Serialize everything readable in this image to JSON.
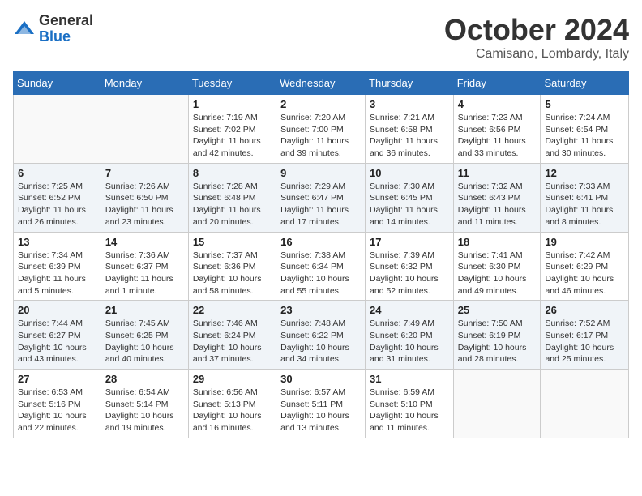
{
  "header": {
    "logo_general": "General",
    "logo_blue": "Blue",
    "month": "October 2024",
    "location": "Camisano, Lombardy, Italy"
  },
  "weekdays": [
    "Sunday",
    "Monday",
    "Tuesday",
    "Wednesday",
    "Thursday",
    "Friday",
    "Saturday"
  ],
  "weeks": [
    [
      {
        "day": "",
        "info": ""
      },
      {
        "day": "",
        "info": ""
      },
      {
        "day": "1",
        "info": "Sunrise: 7:19 AM\nSunset: 7:02 PM\nDaylight: 11 hours and 42 minutes."
      },
      {
        "day": "2",
        "info": "Sunrise: 7:20 AM\nSunset: 7:00 PM\nDaylight: 11 hours and 39 minutes."
      },
      {
        "day": "3",
        "info": "Sunrise: 7:21 AM\nSunset: 6:58 PM\nDaylight: 11 hours and 36 minutes."
      },
      {
        "day": "4",
        "info": "Sunrise: 7:23 AM\nSunset: 6:56 PM\nDaylight: 11 hours and 33 minutes."
      },
      {
        "day": "5",
        "info": "Sunrise: 7:24 AM\nSunset: 6:54 PM\nDaylight: 11 hours and 30 minutes."
      }
    ],
    [
      {
        "day": "6",
        "info": "Sunrise: 7:25 AM\nSunset: 6:52 PM\nDaylight: 11 hours and 26 minutes."
      },
      {
        "day": "7",
        "info": "Sunrise: 7:26 AM\nSunset: 6:50 PM\nDaylight: 11 hours and 23 minutes."
      },
      {
        "day": "8",
        "info": "Sunrise: 7:28 AM\nSunset: 6:48 PM\nDaylight: 11 hours and 20 minutes."
      },
      {
        "day": "9",
        "info": "Sunrise: 7:29 AM\nSunset: 6:47 PM\nDaylight: 11 hours and 17 minutes."
      },
      {
        "day": "10",
        "info": "Sunrise: 7:30 AM\nSunset: 6:45 PM\nDaylight: 11 hours and 14 minutes."
      },
      {
        "day": "11",
        "info": "Sunrise: 7:32 AM\nSunset: 6:43 PM\nDaylight: 11 hours and 11 minutes."
      },
      {
        "day": "12",
        "info": "Sunrise: 7:33 AM\nSunset: 6:41 PM\nDaylight: 11 hours and 8 minutes."
      }
    ],
    [
      {
        "day": "13",
        "info": "Sunrise: 7:34 AM\nSunset: 6:39 PM\nDaylight: 11 hours and 5 minutes."
      },
      {
        "day": "14",
        "info": "Sunrise: 7:36 AM\nSunset: 6:37 PM\nDaylight: 11 hours and 1 minute."
      },
      {
        "day": "15",
        "info": "Sunrise: 7:37 AM\nSunset: 6:36 PM\nDaylight: 10 hours and 58 minutes."
      },
      {
        "day": "16",
        "info": "Sunrise: 7:38 AM\nSunset: 6:34 PM\nDaylight: 10 hours and 55 minutes."
      },
      {
        "day": "17",
        "info": "Sunrise: 7:39 AM\nSunset: 6:32 PM\nDaylight: 10 hours and 52 minutes."
      },
      {
        "day": "18",
        "info": "Sunrise: 7:41 AM\nSunset: 6:30 PM\nDaylight: 10 hours and 49 minutes."
      },
      {
        "day": "19",
        "info": "Sunrise: 7:42 AM\nSunset: 6:29 PM\nDaylight: 10 hours and 46 minutes."
      }
    ],
    [
      {
        "day": "20",
        "info": "Sunrise: 7:44 AM\nSunset: 6:27 PM\nDaylight: 10 hours and 43 minutes."
      },
      {
        "day": "21",
        "info": "Sunrise: 7:45 AM\nSunset: 6:25 PM\nDaylight: 10 hours and 40 minutes."
      },
      {
        "day": "22",
        "info": "Sunrise: 7:46 AM\nSunset: 6:24 PM\nDaylight: 10 hours and 37 minutes."
      },
      {
        "day": "23",
        "info": "Sunrise: 7:48 AM\nSunset: 6:22 PM\nDaylight: 10 hours and 34 minutes."
      },
      {
        "day": "24",
        "info": "Sunrise: 7:49 AM\nSunset: 6:20 PM\nDaylight: 10 hours and 31 minutes."
      },
      {
        "day": "25",
        "info": "Sunrise: 7:50 AM\nSunset: 6:19 PM\nDaylight: 10 hours and 28 minutes."
      },
      {
        "day": "26",
        "info": "Sunrise: 7:52 AM\nSunset: 6:17 PM\nDaylight: 10 hours and 25 minutes."
      }
    ],
    [
      {
        "day": "27",
        "info": "Sunrise: 6:53 AM\nSunset: 5:16 PM\nDaylight: 10 hours and 22 minutes."
      },
      {
        "day": "28",
        "info": "Sunrise: 6:54 AM\nSunset: 5:14 PM\nDaylight: 10 hours and 19 minutes."
      },
      {
        "day": "29",
        "info": "Sunrise: 6:56 AM\nSunset: 5:13 PM\nDaylight: 10 hours and 16 minutes."
      },
      {
        "day": "30",
        "info": "Sunrise: 6:57 AM\nSunset: 5:11 PM\nDaylight: 10 hours and 13 minutes."
      },
      {
        "day": "31",
        "info": "Sunrise: 6:59 AM\nSunset: 5:10 PM\nDaylight: 10 hours and 11 minutes."
      },
      {
        "day": "",
        "info": ""
      },
      {
        "day": "",
        "info": ""
      }
    ]
  ]
}
